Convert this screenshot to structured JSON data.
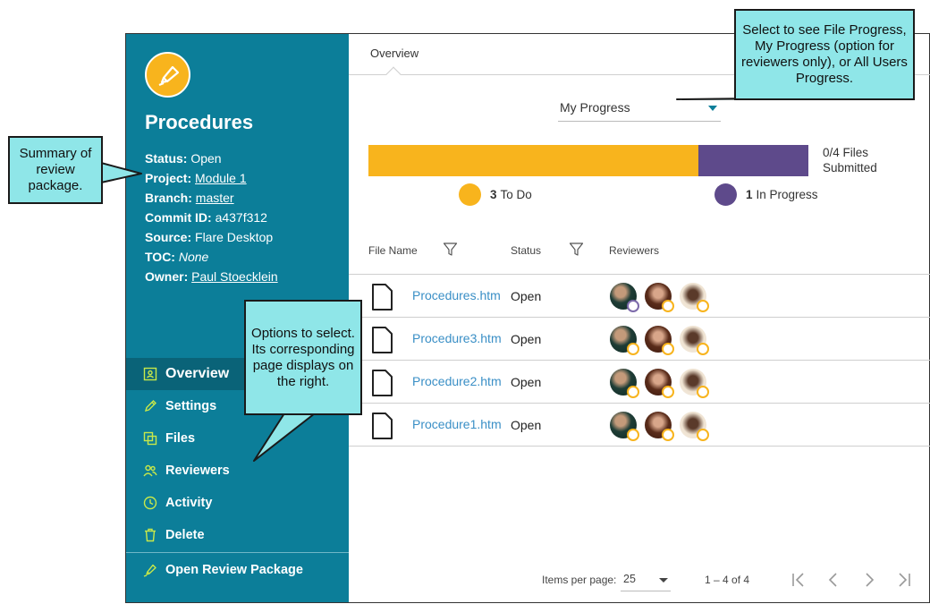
{
  "package": {
    "title": "Procedures",
    "status_label": "Status:",
    "status": "Open",
    "project_label": "Project:",
    "project": "Module 1",
    "branch_label": "Branch:",
    "branch": "master",
    "commit_label": "Commit ID:",
    "commit": "a437f312",
    "source_label": "Source:",
    "source": "Flare Desktop",
    "toc_label": "TOC:",
    "toc": "None",
    "owner_label": "Owner:",
    "owner": "Paul Stoecklein"
  },
  "nav": {
    "items": [
      {
        "label": "Overview",
        "icon": "overview-icon"
      },
      {
        "label": "Settings",
        "icon": "pencil-icon"
      },
      {
        "label": "Files",
        "icon": "files-icon"
      },
      {
        "label": "Reviewers",
        "icon": "people-icon"
      },
      {
        "label": "Activity",
        "icon": "clock-icon"
      },
      {
        "label": "Delete",
        "icon": "trash-icon"
      }
    ],
    "open_package": "Open Review Package"
  },
  "tabs": {
    "overview": "Overview"
  },
  "progress": {
    "selected": "My Progress",
    "todo_fraction": 0.75,
    "files_submitted": "0/4 Files Submitted",
    "todo_count": "3",
    "todo_label": "To Do",
    "inprogress_count": "1",
    "inprogress_label": "In Progress"
  },
  "table": {
    "headers": {
      "file_name": "File Name",
      "status": "Status",
      "reviewers": "Reviewers"
    },
    "rows": [
      {
        "file": "Procedures.htm",
        "status": "Open"
      },
      {
        "file": "Procedure3.htm",
        "status": "Open"
      },
      {
        "file": "Procedure2.htm",
        "status": "Open"
      },
      {
        "file": "Procedure1.htm",
        "status": "Open"
      }
    ]
  },
  "pager": {
    "items_per_page_label": "Items per page:",
    "items_per_page": "25",
    "range": "1 – 4 of 4"
  },
  "callouts": {
    "summary": "Summary of review package.",
    "progress": "Select to see File Progress, My Progress (option for reviewers only), or All Users Progress.",
    "options": "Options to select. Its corresponding page displays on the right."
  },
  "colors": {
    "sidebar": "#0c7e99",
    "todo": "#f8b41d",
    "in_progress": "#5e4a8b",
    "callout": "#8fe6e8"
  }
}
